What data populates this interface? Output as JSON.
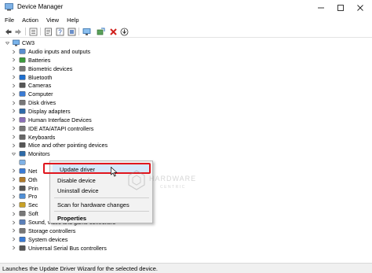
{
  "window": {
    "title": "Device Manager"
  },
  "menubar": {
    "items": [
      "File",
      "Action",
      "View",
      "Help"
    ]
  },
  "toolbar": {
    "buttons": [
      "back-icon",
      "forward-icon",
      "tree-view-icon",
      "properties-icon",
      "help-icon",
      "resources-icon",
      "monitor-icon",
      "scan-hardware-icon",
      "uninstall-icon",
      "download-driver-icon"
    ]
  },
  "tree": {
    "root": "CW3",
    "items": [
      {
        "label": "Audio inputs and outputs",
        "icon": "audio-icon"
      },
      {
        "label": "Batteries",
        "icon": "battery-icon"
      },
      {
        "label": "Biometric devices",
        "icon": "biometric-icon"
      },
      {
        "label": "Bluetooth",
        "icon": "bluetooth-icon"
      },
      {
        "label": "Cameras",
        "icon": "camera-icon"
      },
      {
        "label": "Computer",
        "icon": "computer-icon"
      },
      {
        "label": "Disk drives",
        "icon": "disk-icon"
      },
      {
        "label": "Display adapters",
        "icon": "display-adapter-icon"
      },
      {
        "label": "Human Interface Devices",
        "icon": "hid-icon"
      },
      {
        "label": "IDE ATA/ATAPI controllers",
        "icon": "ide-icon"
      },
      {
        "label": "Keyboards",
        "icon": "keyboard-icon"
      },
      {
        "label": "Mice and other pointing devices",
        "icon": "mouse-icon"
      },
      {
        "label": "Monitors",
        "icon": "monitor-icon",
        "expanded": true
      },
      {
        "label": "",
        "icon": "monitor-device-icon",
        "child": true
      },
      {
        "label": "Net",
        "icon": "network-icon"
      },
      {
        "label": "Oth",
        "icon": "other-icon"
      },
      {
        "label": "Prin",
        "icon": "printer-icon"
      },
      {
        "label": "Pro",
        "icon": "processor-icon"
      },
      {
        "label": "Sec",
        "icon": "security-icon"
      },
      {
        "label": "Soft",
        "icon": "software-icon"
      },
      {
        "label": "Sound, video and game controllers",
        "icon": "sound-icon"
      },
      {
        "label": "Storage controllers",
        "icon": "storage-icon"
      },
      {
        "label": "System devices",
        "icon": "system-icon"
      },
      {
        "label": "Universal Serial Bus controllers",
        "icon": "usb-icon"
      }
    ]
  },
  "context_menu": {
    "items": [
      {
        "label": "Update driver",
        "selected": true
      },
      {
        "label": "Disable device"
      },
      {
        "label": "Uninstall device"
      },
      {
        "label": "Scan for hardware changes"
      },
      {
        "label": "Properties",
        "bold": true
      }
    ]
  },
  "watermark": {
    "text": "HARDWARE CENTRIC"
  },
  "status": {
    "text": "Launches the Update Driver Wizard for the selected device."
  },
  "colors": {
    "highlight": "#e0161e",
    "selection": "#d6e8fb",
    "accent": "#1e6fd0"
  }
}
